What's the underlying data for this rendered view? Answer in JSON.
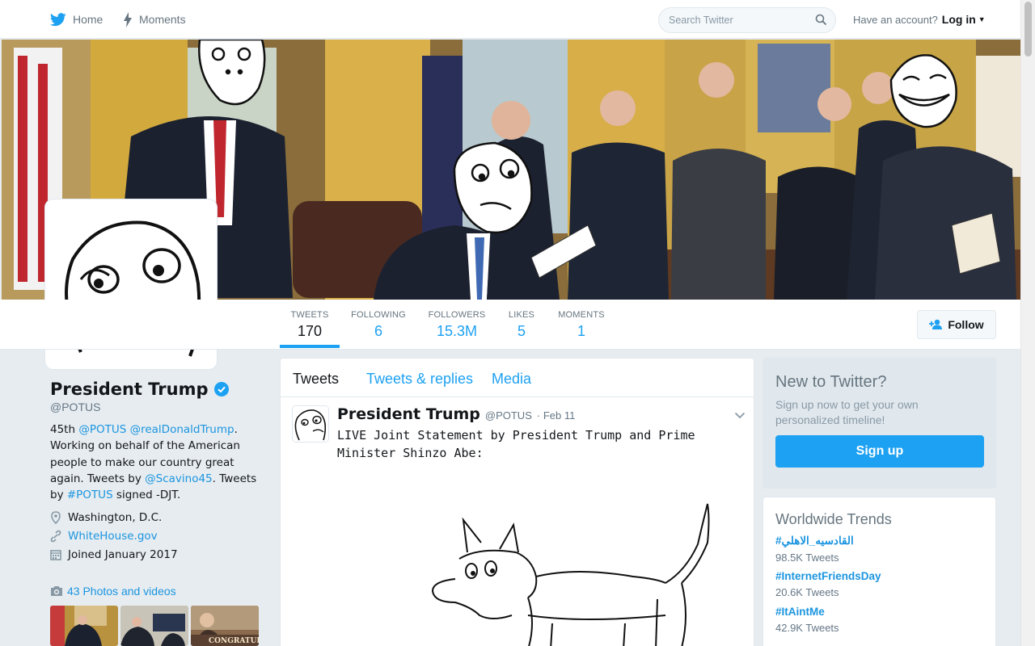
{
  "nav": {
    "home_label": "Home",
    "moments_label": "Moments",
    "search_placeholder": "Search Twitter",
    "account_prompt": "Have an account?",
    "login_label": "Log in"
  },
  "profile": {
    "name": "President Trump",
    "handle": "@POTUS",
    "bio_parts": [
      "45th ",
      "@POTUS",
      " ",
      "@realDonaldTrump",
      ". Working on behalf of the American people to make our country great again. Tweets by ",
      "@Scavino45",
      ". Tweets by ",
      "#POTUS",
      " signed -DJT."
    ],
    "location": "Washington, D.C.",
    "website": "WhiteHouse.gov",
    "joined": "Joined January 2017",
    "photos_label": "43 Photos and videos"
  },
  "stats": [
    {
      "label": "TWEETS",
      "value": "170"
    },
    {
      "label": "FOLLOWING",
      "value": "6"
    },
    {
      "label": "FOLLOWERS",
      "value": "15.3M"
    },
    {
      "label": "LIKES",
      "value": "5"
    },
    {
      "label": "MOMENTS",
      "value": "1"
    }
  ],
  "follow_label": "Follow",
  "timeline": {
    "tabs": [
      "Tweets",
      "Tweets & replies",
      "Media"
    ],
    "tweet": {
      "name": "President Trump",
      "handle": "@POTUS",
      "date": "· Feb 11",
      "text": "LIVE Joint Statement by President Trump and Prime Minister Shinzo Abe:"
    }
  },
  "signup": {
    "heading": "New to Twitter?",
    "subtext": "Sign up now to get your own personalized timeline!",
    "button": "Sign up"
  },
  "trends": {
    "heading": "Worldwide Trends",
    "items": [
      {
        "name": "#القادسيه_الاهلي",
        "count": "98.5K Tweets"
      },
      {
        "name": "#InternetFriendsDay",
        "count": "20.6K Tweets"
      },
      {
        "name": "#ItAintMe",
        "count": "42.9K Tweets"
      }
    ]
  },
  "thumb_caption": "CONGRATULA",
  "colors": {
    "accent": "#1da1f2",
    "link": "#1b95e0",
    "background": "#e6ecf0"
  },
  "icons": [
    "twitter-bird-icon",
    "lightning-icon",
    "search-icon",
    "caret-down-icon",
    "add-user-icon",
    "verified-badge-icon",
    "location-pin-icon",
    "link-icon",
    "calendar-icon",
    "camera-icon",
    "chevron-down-icon"
  ]
}
